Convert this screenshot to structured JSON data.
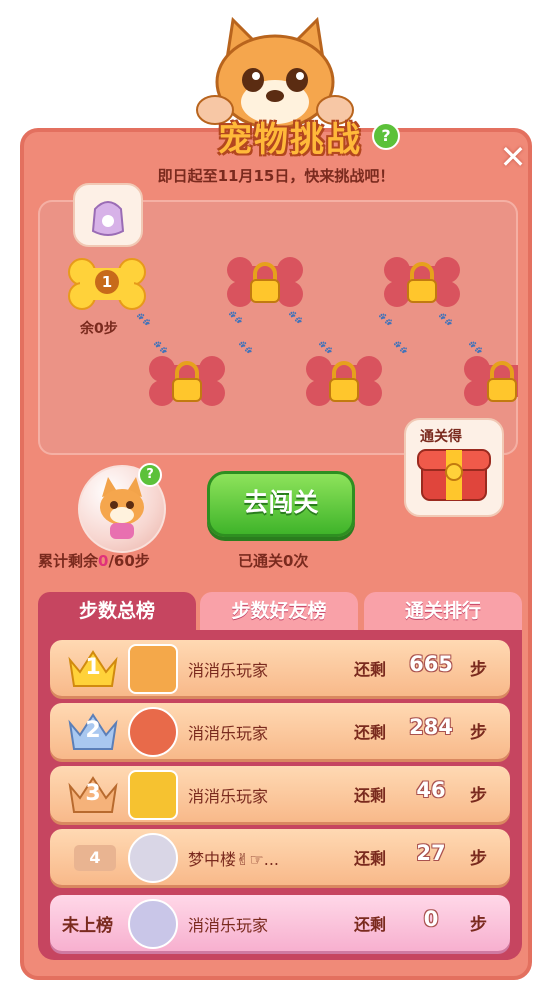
{
  "header": {
    "title": "宠物挑战",
    "help": "?",
    "close": "✕",
    "subtitle": "即日起至11月15日，快来挑战吧！"
  },
  "map": {
    "current_level": "1",
    "current_level_remaining": "余0步",
    "reward_label": "通关得"
  },
  "pet": {
    "help": "?",
    "remaining_prefix": "累计剩余",
    "remaining_value": "0",
    "remaining_suffix": "/60步"
  },
  "actions": {
    "go_label": "去闯关",
    "cleared_text": "已通关0次"
  },
  "tabs": [
    {
      "label": "步数总榜",
      "active": true
    },
    {
      "label": "步数好友榜",
      "active": false
    },
    {
      "label": "通关排行",
      "active": false
    }
  ],
  "leaderboard": [
    {
      "rank": "1",
      "name": "消消乐玩家",
      "remaining_label": "还剩",
      "steps": "665",
      "unit": "步",
      "crown": "gold"
    },
    {
      "rank": "2",
      "name": "消消乐玩家",
      "remaining_label": "还剩",
      "steps": "284",
      "unit": "步",
      "crown": "silver"
    },
    {
      "rank": "3",
      "name": "消消乐玩家",
      "remaining_label": "还剩",
      "steps": "46",
      "unit": "步",
      "crown": "bronze"
    },
    {
      "rank": "4",
      "name": "梦中楼✌☞...",
      "remaining_label": "还剩",
      "steps": "27",
      "unit": "步"
    }
  ],
  "self_row": {
    "rank_label": "未上榜",
    "name": "消消乐玩家",
    "remaining_label": "还剩",
    "steps": "0",
    "unit": "步"
  },
  "colors": {
    "panel": "#f08a78",
    "board": "#c64560",
    "go_button": "#3fb42a"
  }
}
